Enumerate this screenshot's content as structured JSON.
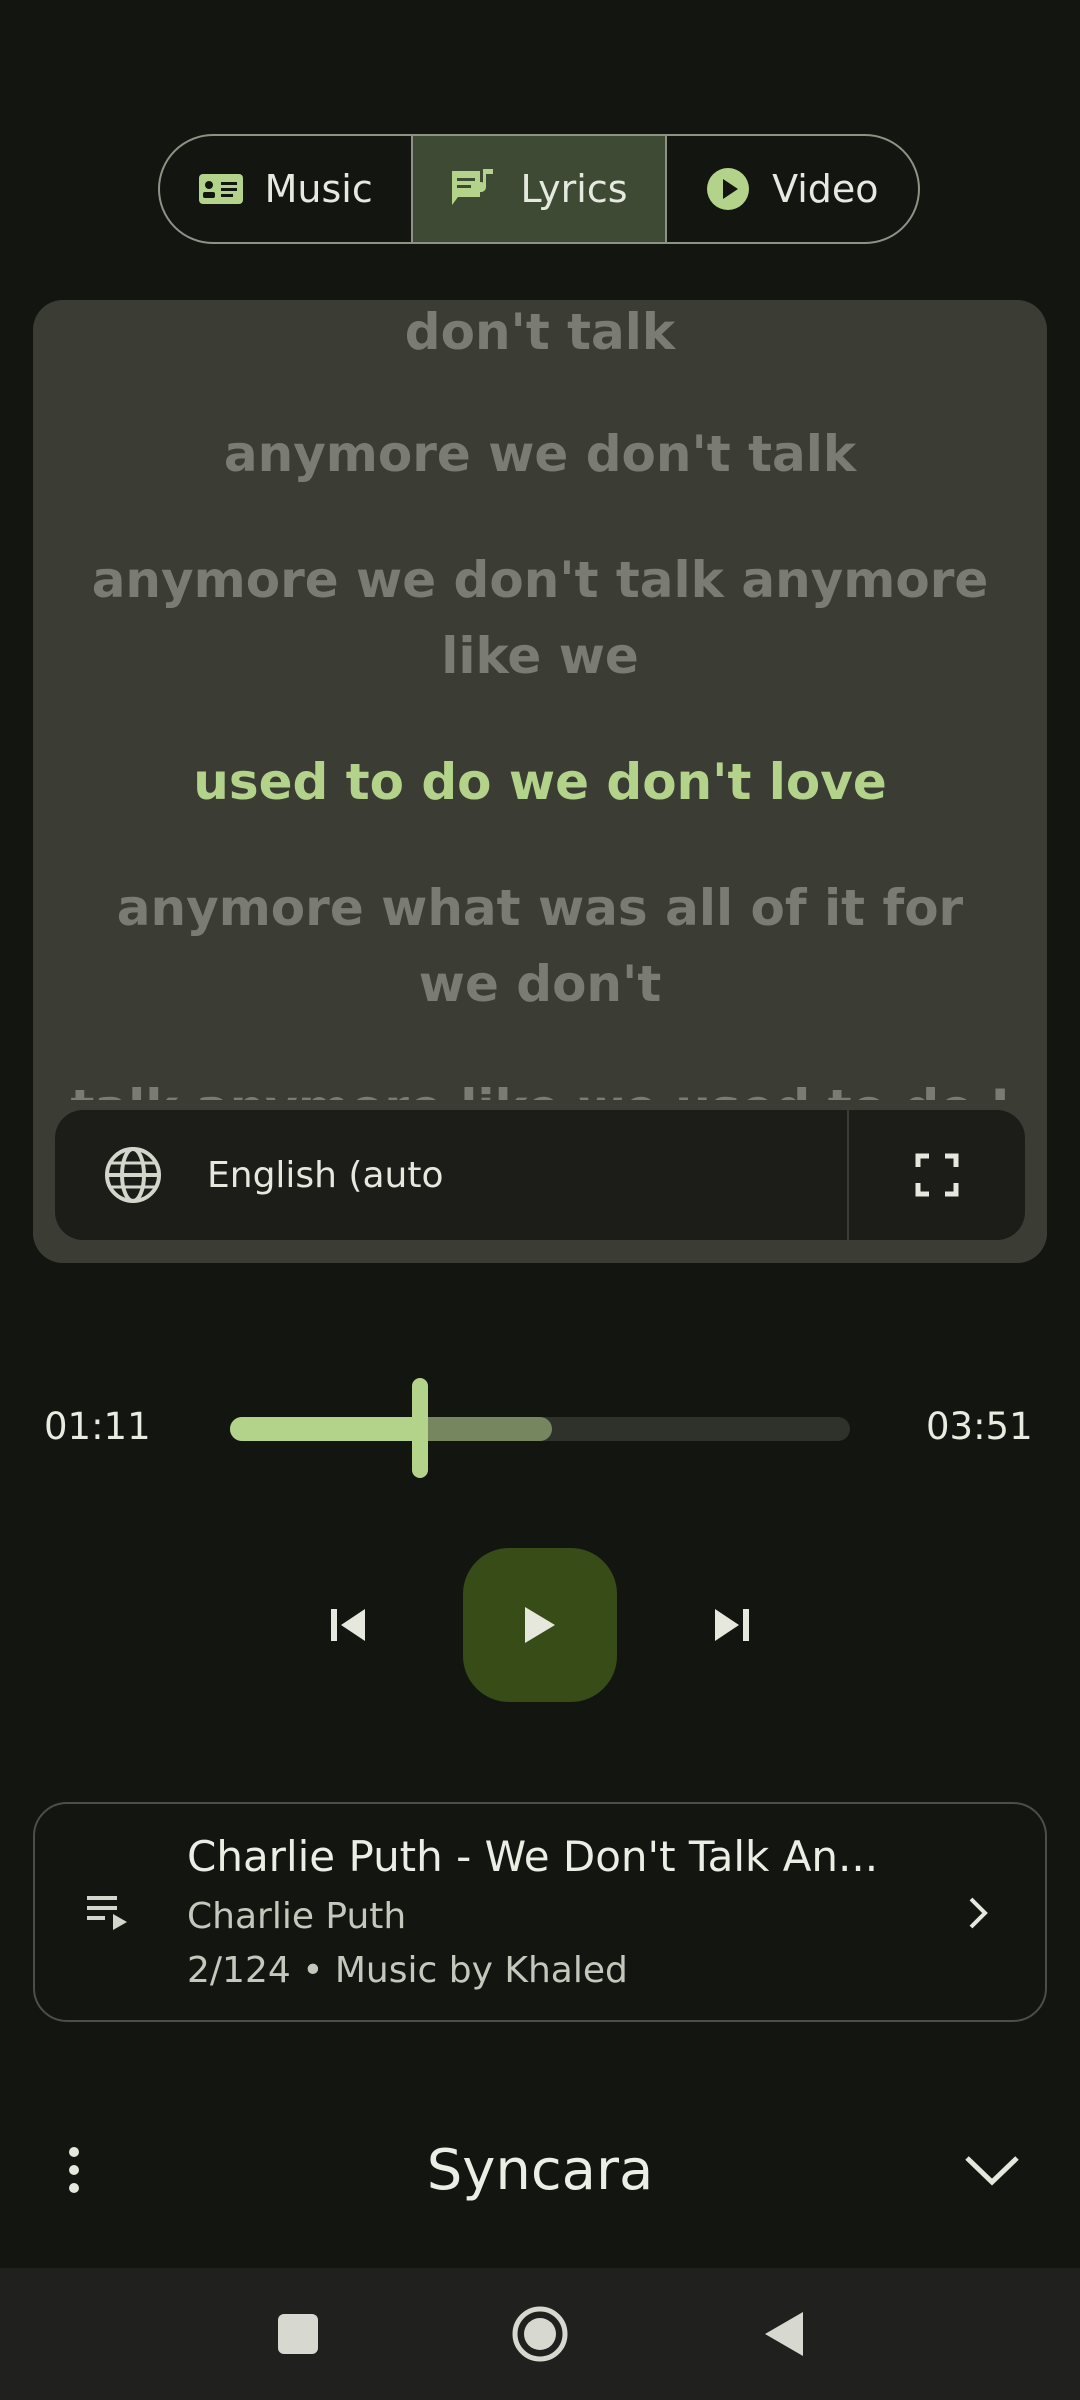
{
  "tabs": [
    {
      "label": "Music",
      "icon": "music-card-icon",
      "active": false
    },
    {
      "label": "Lyrics",
      "icon": "lyrics-icon",
      "active": true
    },
    {
      "label": "Video",
      "icon": "play-circle-icon",
      "active": false
    }
  ],
  "lyrics": {
    "lines": [
      "don't talk",
      "anymore we don't talk",
      "anymore we don't talk anymore like we",
      "used to do we don't love",
      "anymore what was all of it for we don't",
      "talk anymore like we used to do I"
    ],
    "current_line": "used to do we don't love",
    "language": "English (auto"
  },
  "player": {
    "elapsed": "01:11",
    "duration": "03:51",
    "progress_fraction": 0.307,
    "buffered_fraction": 0.52
  },
  "now_playing": {
    "title": "Charlie Puth - We Don't Talk An...",
    "artist": "Charlie Puth",
    "meta": "2/124 • Music by Khaled"
  },
  "app": {
    "name": "Syncara"
  },
  "colors": {
    "accent": "#b4d38a",
    "play_button": "#374c17",
    "active_tab": "#3e4a34",
    "background": "#131511"
  }
}
